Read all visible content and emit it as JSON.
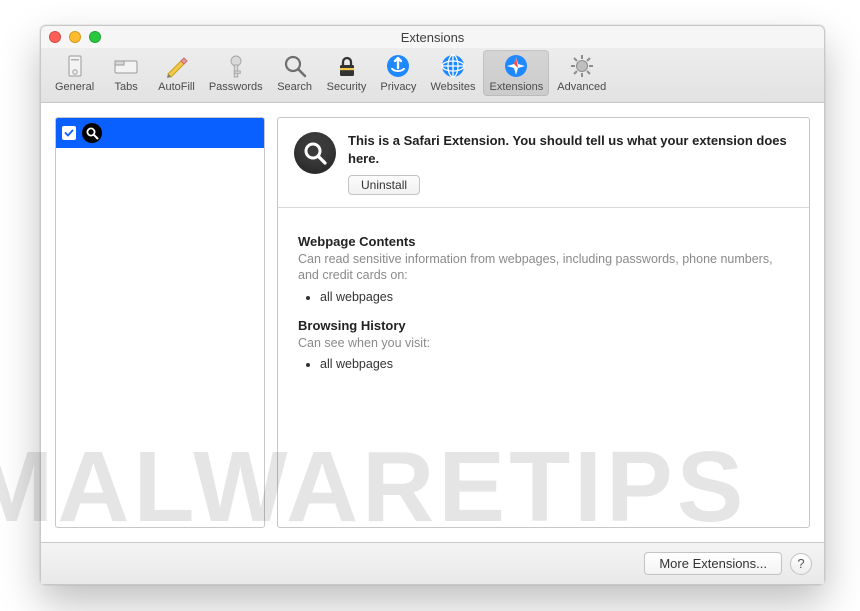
{
  "window": {
    "title": "Extensions"
  },
  "toolbar": {
    "items": [
      {
        "label": "General"
      },
      {
        "label": "Tabs"
      },
      {
        "label": "AutoFill"
      },
      {
        "label": "Passwords"
      },
      {
        "label": "Search"
      },
      {
        "label": "Security"
      },
      {
        "label": "Privacy"
      },
      {
        "label": "Websites"
      },
      {
        "label": "Extensions"
      },
      {
        "label": "Advanced"
      }
    ]
  },
  "detail": {
    "description": "This is a Safari Extension. You should tell us what your extension does here.",
    "uninstall_label": "Uninstall",
    "sections": {
      "webpage_title": "Webpage Contents",
      "webpage_sub": "Can read sensitive information from webpages, including passwords, phone numbers, and credit cards on:",
      "webpage_item": "all webpages",
      "history_title": "Browsing History",
      "history_sub": "Can see when you visit:",
      "history_item": "all webpages"
    }
  },
  "bottom": {
    "more_label": "More Extensions...",
    "help_label": "?"
  },
  "watermark": "MALWARETIPS"
}
